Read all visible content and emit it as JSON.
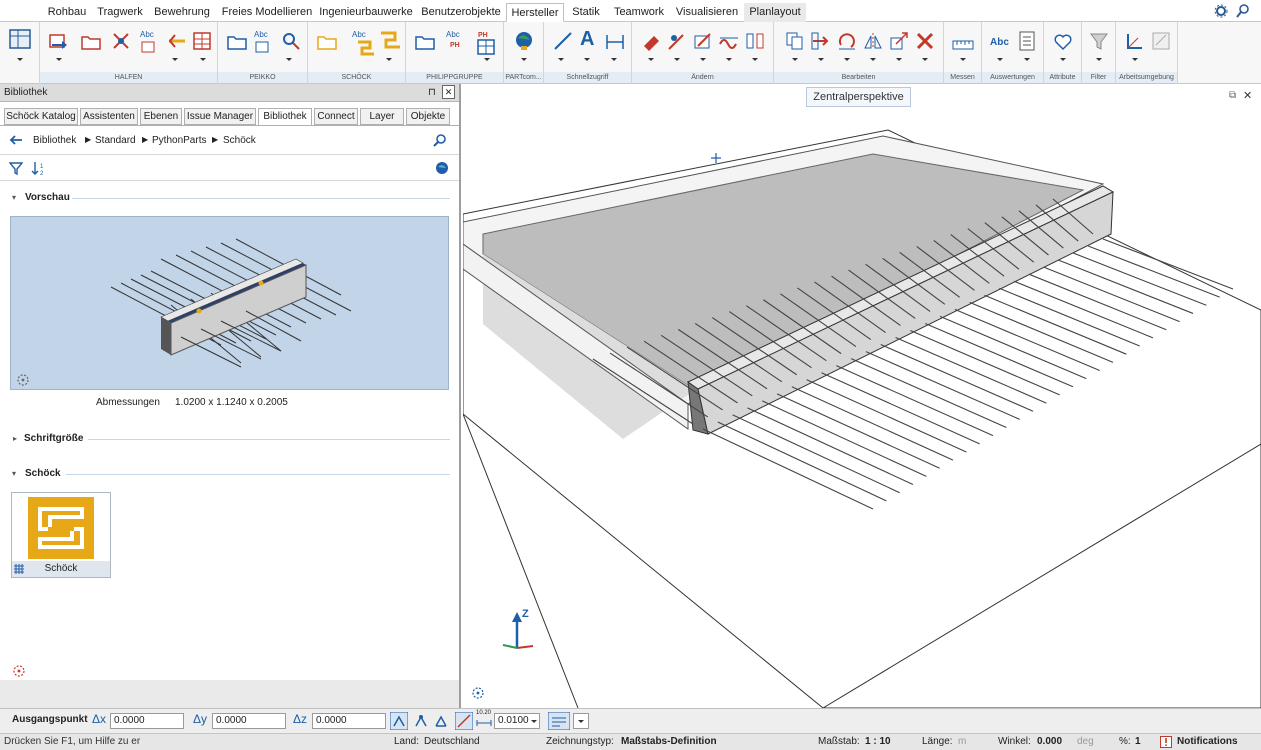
{
  "menu": {
    "tabs": [
      "Rohbau",
      "Tragwerk",
      "Bewehrung",
      "Freies Modellieren",
      "Ingenieurbauwerke",
      "Benutzerobjekte",
      "Hersteller",
      "Statik",
      "Teamwork",
      "Visualisieren",
      "Planlayout"
    ],
    "active": "Hersteller"
  },
  "ribbon": {
    "groups": [
      "HALFEN",
      "PEIKKO",
      "SCHÖCK",
      "PHILIPPGRUPPE",
      "PARTcom...",
      "Schnellzugriff",
      "Ändern",
      "Bearbeiten",
      "Messen",
      "Auswertungen",
      "Attribute",
      "Filter",
      "Arbeitsumgebung"
    ],
    "abc": "Abc",
    "ph": "PH",
    "text_a": "A"
  },
  "panel": {
    "title": "Bibliothek",
    "pin": "⊓",
    "close": "✕",
    "tabs": [
      "Schöck Katalog",
      "Assistenten",
      "Ebenen",
      "Issue Manager",
      "Bibliothek",
      "Connect",
      "Layer",
      "Objekte"
    ],
    "active_tab": "Bibliothek",
    "breadcrumb": [
      "Bibliothek",
      "Standard",
      "PythonParts",
      "Schöck"
    ],
    "sections": {
      "preview": "Vorschau",
      "fontsize": "Schriftgröße",
      "schoeck": "Schöck"
    },
    "dimensions_label": "Abmessungen",
    "dimensions_value": "1.0200 x 1.1240 x 0.2005",
    "item_label": "Schöck"
  },
  "viewport": {
    "title": "Zentralperspektive",
    "axis_z": "Z"
  },
  "coords": {
    "label": "Ausgangspunkt",
    "dx_label": "Δx",
    "dx": "0.0000",
    "dy_label": "Δy",
    "dy": "0.0000",
    "dz_label": "Δz",
    "dz": "0.0000",
    "step": "0.0100",
    "scale_icon_text": "10.20"
  },
  "status": {
    "hint": "Drücken Sie F1, um Hilfe zu er",
    "land_label": "Land:",
    "land": "Deutschland",
    "drawing_label": "Zeichnungstyp:",
    "drawing": "Maßstabs-Definition",
    "scale_label": "Maßstab:",
    "scale": "1 : 10",
    "length_label": "Länge:",
    "length_unit": "m",
    "angle_label": "Winkel:",
    "angle": "0.000",
    "angle_unit": "deg",
    "percent_label": "%:",
    "percent": "1",
    "notifications": "Notifications"
  },
  "colors": {
    "accent": "#1f5ea8",
    "schoeck_yellow": "#e6a817",
    "preview_bg": "#c2d4e8"
  }
}
